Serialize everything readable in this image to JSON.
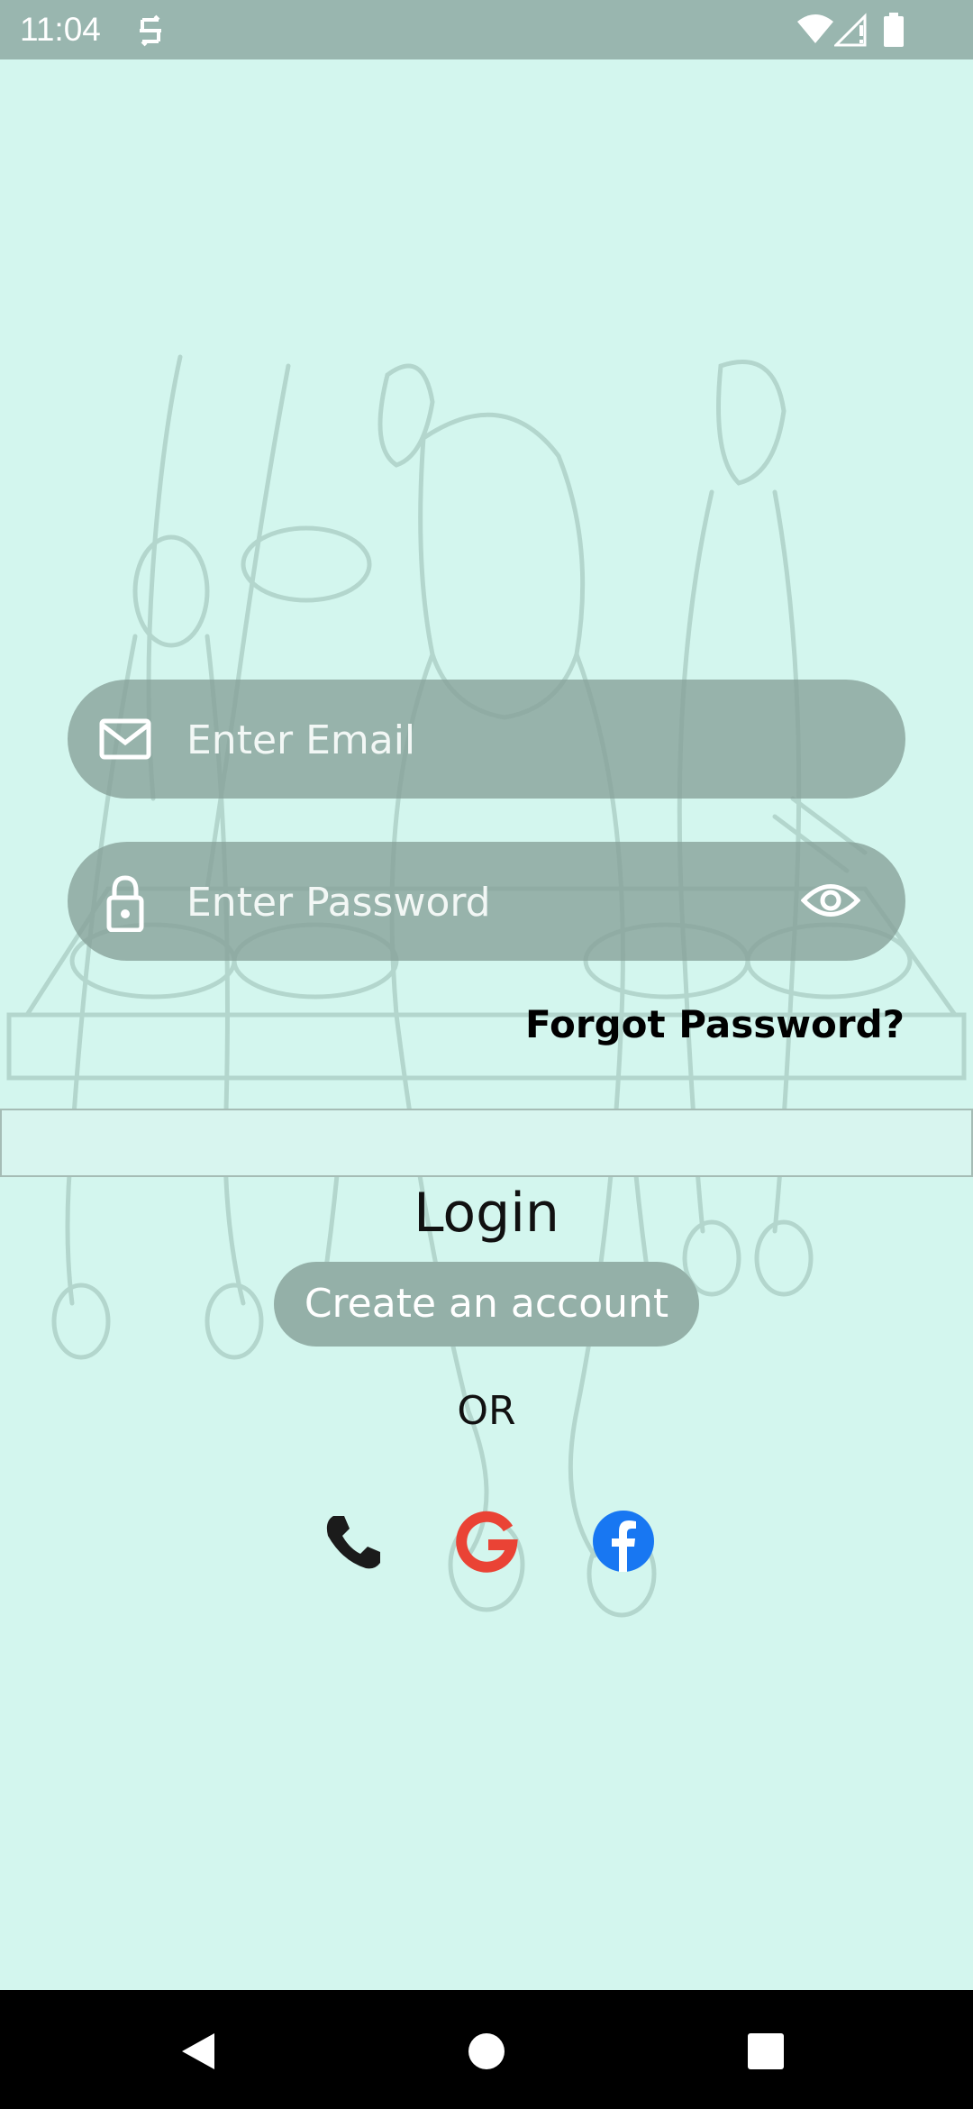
{
  "status_bar": {
    "time": "11:04",
    "icons": [
      "sync-icon",
      "wifi-icon",
      "signal-icon",
      "battery-icon"
    ]
  },
  "login_form": {
    "email_placeholder": "Enter Email",
    "email_value": "",
    "password_placeholder": "Enter Password",
    "password_value": "",
    "forgot_password": "Forgot Password?",
    "login_label": "Login",
    "create_account_label": "Create an account",
    "or_label": "OR"
  },
  "social_logins": [
    {
      "name": "phone-icon",
      "color": "#1b1b1b"
    },
    {
      "name": "google-icon",
      "color": "#ea4335"
    },
    {
      "name": "facebook-icon",
      "color": "#1877f2"
    }
  ],
  "colors": {
    "background": "#d3f6ee",
    "status_bar": "#99b6af",
    "field_fill": "#87a099",
    "button_fill": "#94b0a8"
  }
}
